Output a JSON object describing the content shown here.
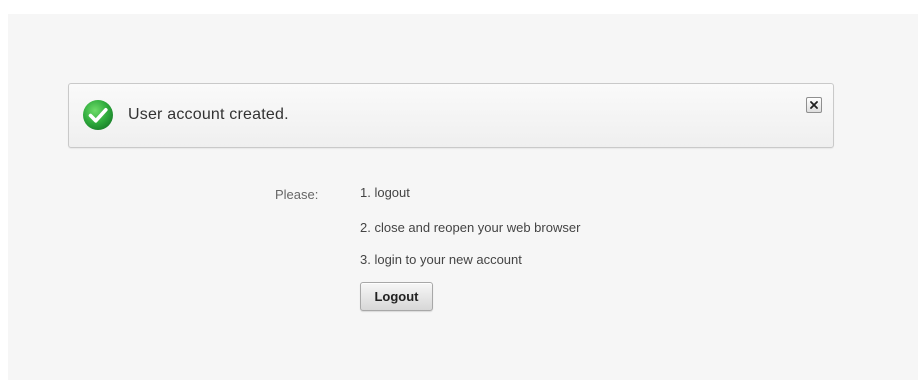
{
  "alert": {
    "icon": "checkmark-circle-icon",
    "icon_color": "#2eaa3c",
    "message": "User account created.",
    "close_icon": "close-x-icon"
  },
  "instructions": {
    "label": "Please:",
    "steps": [
      "1. logout",
      "2. close and reopen your web browser",
      "3. login to your new account"
    ]
  },
  "logout_button": {
    "label": "Logout"
  }
}
